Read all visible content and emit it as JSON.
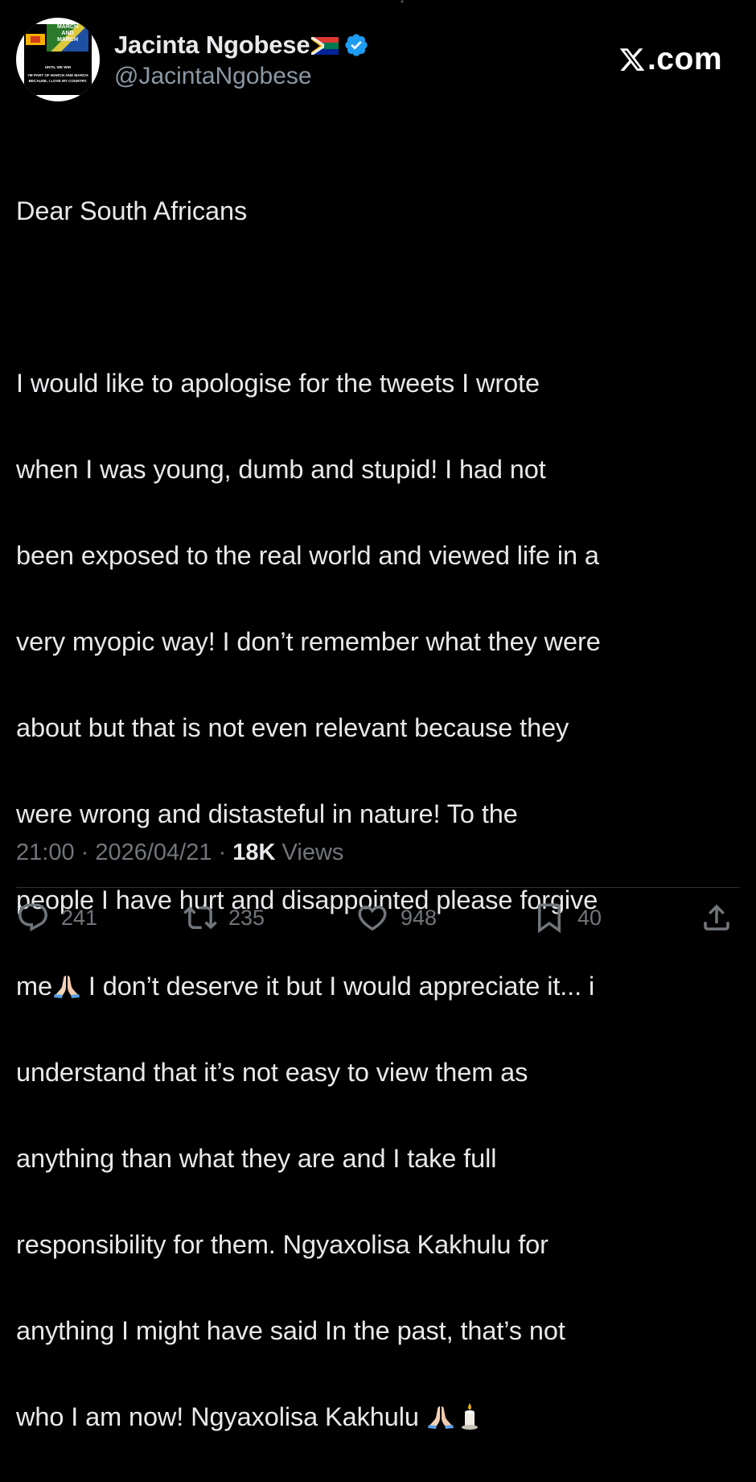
{
  "profile": {
    "display_name": "Jacinta Ngobese",
    "handle": "@JacintaNgobese",
    "avatar": {
      "title_lines": [
        "MARCH",
        "AND",
        "MARCH"
      ],
      "subtitle": "UNTIL WE WIN",
      "caption": "I'M PART OF MARCH AND MARCH BECAUSE, I LOVE MY COUNTRY."
    }
  },
  "brand": {
    "site": ".com"
  },
  "tweet": {
    "greeting": "Dear South Africans",
    "lines": [
      "I would like to apologise for the tweets I wrote",
      "when I was young, dumb and stupid! I had not",
      "been exposed to the real world and viewed life in a",
      "very myopic way! I don’t remember what they were",
      "about but that is not even relevant because they",
      "were wrong and distasteful in nature! To the",
      "people I have hurt and disappointed please forgive"
    ],
    "line_me_start": "me",
    "line_me_end": " I  don’t deserve it but I would appreciate it... i",
    "lines_after": [
      "understand that it’s not easy to view them as",
      "anything than what they are and I take full",
      "responsibility for them. Ngyaxolisa Kakhulu for",
      "anything I might have said In the past, that’s not"
    ],
    "last_line": "who I am now! Ngyaxolisa Kakhulu "
  },
  "meta": {
    "time": "21:00",
    "separator": " · ",
    "date": "2026/04/21",
    "views_count": "18K",
    "views_label": " Views"
  },
  "actions": {
    "replies": "241",
    "reposts": "235",
    "likes": "948",
    "bookmarks": "40"
  },
  "colors": {
    "background": "#000000",
    "text": "#e7e9ea",
    "secondary": "#71767b",
    "handle": "#8b98a5",
    "verified": "#1d9bf0"
  }
}
